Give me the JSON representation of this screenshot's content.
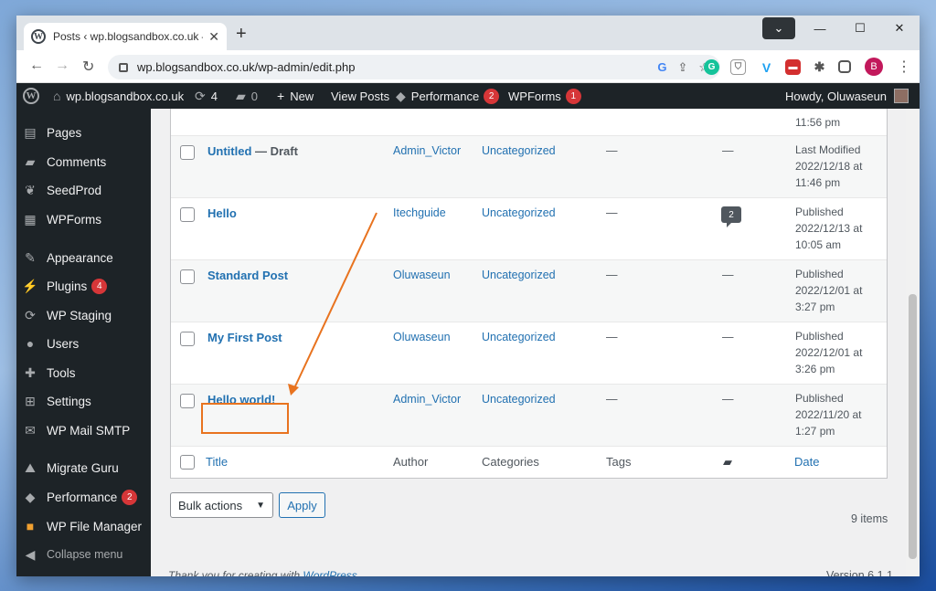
{
  "browser": {
    "tab_title": "Posts ‹ wp.blogsandbox.co.uk —",
    "url": "wp.blogsandbox.co.uk/wp-admin/edit.php",
    "avatar_letter": "B"
  },
  "adminbar": {
    "site": "wp.blogsandbox.co.uk",
    "updates": "4",
    "comments": "0",
    "new_label": "New",
    "view_posts": "View Posts",
    "performance": "Performance",
    "performance_badge": "2",
    "wpforms": "WPForms",
    "wpforms_badge": "1",
    "howdy": "Howdy, Oluwaseun"
  },
  "sidebar": {
    "items": [
      {
        "label": "Pages",
        "icon": "pages-icon"
      },
      {
        "label": "Comments",
        "icon": "comments-icon"
      },
      {
        "label": "SeedProd",
        "icon": "seedprod-icon"
      },
      {
        "label": "WPForms",
        "icon": "wpforms-icon"
      },
      {
        "label": "Appearance",
        "icon": "appearance-icon"
      },
      {
        "label": "Plugins",
        "icon": "plugins-icon",
        "badge": "4"
      },
      {
        "label": "WP Staging",
        "icon": "staging-icon"
      },
      {
        "label": "Users",
        "icon": "users-icon"
      },
      {
        "label": "Tools",
        "icon": "tools-icon"
      },
      {
        "label": "Settings",
        "icon": "settings-icon"
      },
      {
        "label": "WP Mail SMTP",
        "icon": "mail-icon"
      },
      {
        "label": "Migrate Guru",
        "icon": "migrate-icon"
      },
      {
        "label": "Performance",
        "icon": "performance-icon",
        "badge": "2"
      },
      {
        "label": "WP File Manager",
        "icon": "folder-icon"
      }
    ],
    "collapse": "Collapse menu"
  },
  "posts": {
    "top_date_partial": "11:56 pm",
    "rows": [
      {
        "title": "Untitled",
        "state": " — Draft",
        "author": "Admin_Victor",
        "category": "Uncategorized",
        "tags": "—",
        "comments": "—",
        "date_status": "Last Modified",
        "date": "2022/12/18 at",
        "time": "11:46 pm"
      },
      {
        "title": "Hello",
        "state": "",
        "author": "Itechguide",
        "category": "Uncategorized",
        "tags": "—",
        "comments": "2",
        "date_status": "Published",
        "date": "2022/12/13 at",
        "time": "10:05 am"
      },
      {
        "title": "Standard Post",
        "state": "",
        "author": "Oluwaseun",
        "category": "Uncategorized",
        "tags": "—",
        "comments": "—",
        "date_status": "Published",
        "date": "2022/12/01 at",
        "time": "3:27 pm"
      },
      {
        "title": "My First Post",
        "state": "",
        "author": "Oluwaseun",
        "category": "Uncategorized",
        "tags": "—",
        "comments": "—",
        "date_status": "Published",
        "date": "2022/12/01 at",
        "time": "3:26 pm"
      },
      {
        "title": "Hello world!",
        "state": "",
        "author": "Admin_Victor",
        "category": "Uncategorized",
        "tags": "—",
        "comments": "—",
        "date_status": "Published",
        "date": "2022/11/20 at",
        "time": "1:27 pm"
      }
    ],
    "footer_headers": {
      "title": "Title",
      "author": "Author",
      "categories": "Categories",
      "tags": "Tags",
      "date": "Date"
    }
  },
  "bulk": {
    "label": "Bulk actions",
    "apply": "Apply",
    "items_count": "9 items"
  },
  "footer": {
    "thanks_prefix": "Thank you for creating with ",
    "thanks_link": "WordPress",
    "thanks_suffix": ".",
    "version": "Version 6.1.1"
  },
  "colors": {
    "annotation": "#e8731f",
    "link": "#2271b1",
    "badge": "#d63638"
  }
}
